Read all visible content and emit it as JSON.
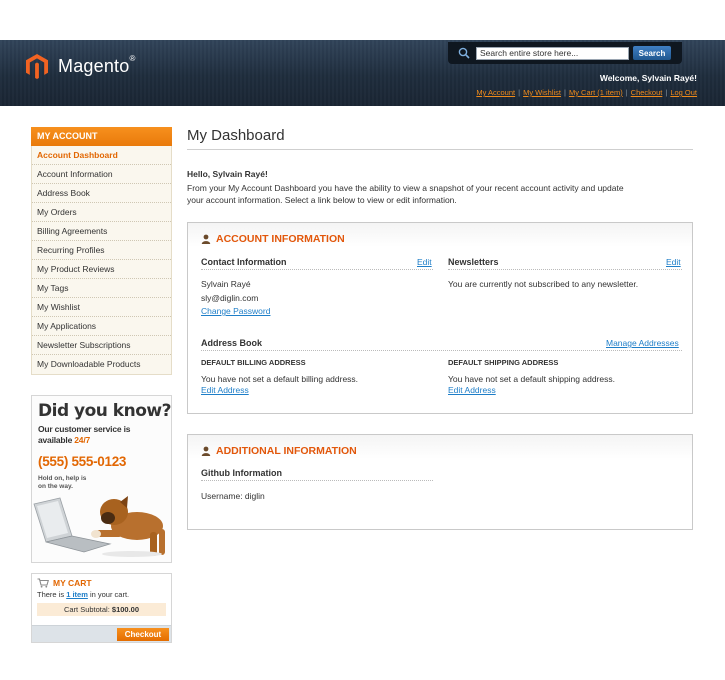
{
  "header": {
    "logo_text": "Magento",
    "logo_reg": "®",
    "search_placeholder": "Search entire store here...",
    "search_button": "Search",
    "welcome": "Welcome, Sylvain Rayé!",
    "links": [
      "My Account",
      "My Wishlist",
      "My Cart (1 item)",
      "Checkout",
      "Log Out"
    ],
    "separator": "|"
  },
  "sidebar": {
    "title": "MY ACCOUNT",
    "items": [
      "Account Dashboard",
      "Account Information",
      "Address Book",
      "My Orders",
      "Billing Agreements",
      "Recurring Profiles",
      "My Product Reviews",
      "My Tags",
      "My Wishlist",
      "My Applications",
      "Newsletter Subscriptions",
      "My Downloadable Products"
    ]
  },
  "did_you_know": {
    "title": "Did you know?",
    "line1": "Our customer service is",
    "line2_prefix": "available ",
    "line2_highlight": "24/7",
    "phone": "(555) 555-0123",
    "small1": "Hold on, help is",
    "small2": "on the way."
  },
  "cart": {
    "title": "MY CART",
    "text_prefix": "There is ",
    "item_link": "1 item",
    "text_suffix": " in your cart.",
    "subtotal_label": "Cart Subtotal: ",
    "subtotal_value": "$100.00",
    "checkout": "Checkout"
  },
  "main": {
    "title": "My Dashboard",
    "hello": "Hello, Sylvain Rayé!",
    "intro": "From your My Account Dashboard you have the ability to view a snapshot of your recent account activity and update your account information. Select a link below to view or edit information.",
    "account_info": {
      "title": "ACCOUNT INFORMATION",
      "contact_head": "Contact Information",
      "contact_edit": "Edit",
      "name": "Sylvain Rayé",
      "email": "sly@diglin.com",
      "change_password": "Change Password",
      "newsletters_head": "Newsletters",
      "newsletters_edit": "Edit",
      "newsletters_text": "You are currently not subscribed to any newsletter.",
      "address_head": "Address Book",
      "manage_addresses": "Manage Addresses",
      "billing_head": "DEFAULT BILLING ADDRESS",
      "billing_text": "You have not set a default billing address.",
      "billing_edit": "Edit Address",
      "shipping_head": "DEFAULT SHIPPING ADDRESS",
      "shipping_text": "You have not set a default shipping address.",
      "shipping_edit": "Edit Address"
    },
    "additional_info": {
      "title": "ADDITIONAL INFORMATION",
      "github_head": "Github Information",
      "username": "Username: diglin"
    }
  },
  "colors": {
    "accent_orange": "#e97a0b",
    "link_blue": "#1e7ec8",
    "header_dark": "#1f2d3d"
  }
}
